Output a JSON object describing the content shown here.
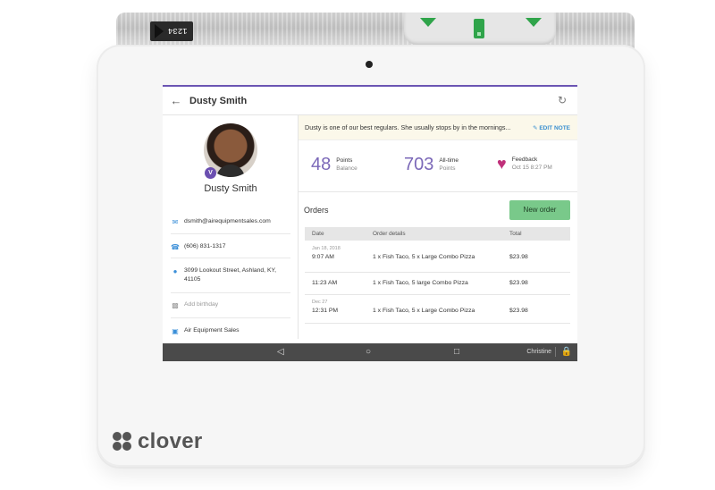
{
  "device": {
    "brand": "clover",
    "paper_code": "1234",
    "accent_color": "#2fa44a"
  },
  "header": {
    "title": "Dusty Smith"
  },
  "customer": {
    "name": "Dusty Smith",
    "badge": "V",
    "email": "dsmith@airequipmentsales.com",
    "phone": "(606) 831-1317",
    "address": "3099 Lookout Street, Ashland, KY, 41105",
    "birthday_placeholder": "Add birthday",
    "company": "Air Equipment Sales"
  },
  "note": {
    "text": "Dusty is one of our best regulars. She usually stops by in the mornings...",
    "edit_label": "EDIT NOTE"
  },
  "stats": {
    "points_value": "48",
    "points_label": "Points",
    "points_sub": "Balance",
    "alltime_value": "703",
    "alltime_label": "All-time",
    "alltime_sub": "Points",
    "feedback_label": "Feedback",
    "feedback_date": "Oct 15 8:27 PM"
  },
  "orders": {
    "title": "Orders",
    "new_order_label": "New order",
    "columns": [
      "Date",
      "Order details",
      "Total"
    ],
    "rows": [
      {
        "date_header": "Jan 18, 2018",
        "time": "9:07 AM",
        "details": "1 x Fish Taco, 5 x Large Combo Pizza",
        "total": "$23.98"
      },
      {
        "date_header": "",
        "time": "11:23 AM",
        "details": "1 x Fish Taco, 5 large Combo Pizza",
        "total": "$23.98"
      },
      {
        "date_header": "Dec 27",
        "time": "12:31 PM",
        "details": "1 x Fish Taco, 5 x Large Combo Pizza",
        "total": "$23.98"
      }
    ]
  },
  "nav_bar": {
    "employee": "Christine"
  }
}
